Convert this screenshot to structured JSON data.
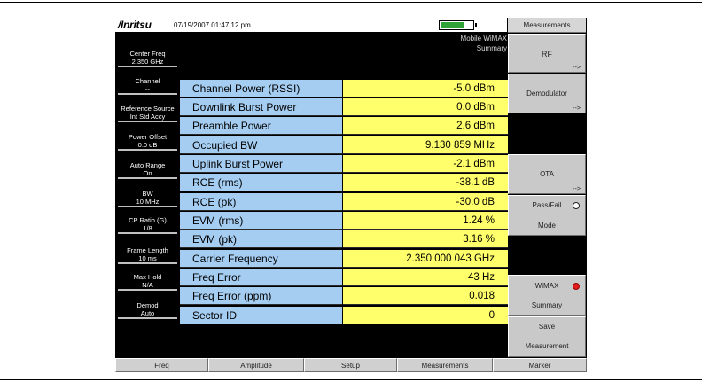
{
  "header": {
    "brand": "/Inritsu",
    "datetime": "07/19/2007 01:47:12 pm",
    "battery_level": 0.72,
    "battery_color": "#2fa336",
    "mode_line1": "Mobile WiMAX",
    "mode_line2": "Summary"
  },
  "left_panel": [
    {
      "label": "Center Freq",
      "value": "2.350 GHz"
    },
    {
      "label": "Channel",
      "value": "--"
    },
    {
      "label": "Reference Source",
      "value": "Int Std Accy"
    },
    {
      "label": "Power Offset",
      "value": "0.0 dB"
    },
    {
      "label": "Auto Range",
      "value": "On"
    },
    {
      "label": "BW",
      "value": "10 MHz"
    },
    {
      "label": "CP Ratio (G)",
      "value": "1/8"
    },
    {
      "label": "Frame Length",
      "value": "10 ms"
    },
    {
      "label": "Max Hold",
      "value": "N/A"
    },
    {
      "label": "Demod",
      "value": "Auto"
    }
  ],
  "table": {
    "label_color": "#a5cdf2",
    "value_color": "#ffff6b",
    "rows": [
      {
        "label": "Channel Power (RSSI)",
        "value": "-5.0 dBm"
      },
      {
        "label": "Downlink Burst Power",
        "value": "0.0 dBm"
      },
      {
        "label": "Preamble Power",
        "value": "2.6 dBm"
      },
      {
        "label": "Occupied BW",
        "value": "9.130 859 MHz"
      },
      {
        "label": "Uplink Burst Power",
        "value": "-2.1 dBm"
      },
      {
        "label": "RCE (rms)",
        "value": "-38.1 dB"
      },
      {
        "label": "RCE (pk)",
        "value": "-30.0 dB"
      },
      {
        "label": "EVM (rms)",
        "value": "1.24 %"
      },
      {
        "label": "EVM (pk)",
        "value": "3.16 %"
      },
      {
        "label": "Carrier Frequency",
        "value": "2.350 000 043 GHz"
      },
      {
        "label": "Freq Error",
        "value": "43 Hz"
      },
      {
        "label": "Freq Error (ppm)",
        "value": "0.018"
      },
      {
        "label": "Sector ID",
        "value": "0"
      }
    ]
  },
  "softkeys": {
    "title": "Measurements",
    "rf": {
      "label": "RF",
      "arrow": "-->"
    },
    "demodulator": {
      "label": "Demodulator",
      "arrow": "-->"
    },
    "ota": {
      "label": "OTA",
      "arrow": "-->"
    },
    "pass_fail": {
      "line1": "Pass/Fail",
      "line2": "Mode"
    },
    "wimax_summary": {
      "line1": "WiMAX",
      "line2": "Summary",
      "indicator_color": "#e21c1c"
    },
    "save_measurement": {
      "line1": "Save",
      "line2": "Measurement"
    }
  },
  "bottom_tabs": [
    "Freq",
    "Amplitude",
    "Setup",
    "Measurements",
    "Marker"
  ]
}
